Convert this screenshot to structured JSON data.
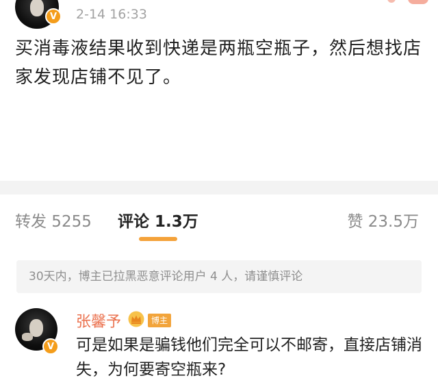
{
  "post": {
    "time": "2-14 16:33",
    "body": "买消毒液结果收到快递是两瓶空瓶子，然后想找店家发现店铺不见了。",
    "verified_badge": "V"
  },
  "tabs": {
    "repost": "转发 5255",
    "comment": "评论 1.3万",
    "like": "赞 23.5万"
  },
  "notice": {
    "text": "30天内，博主已拉黑恶意评论用户 4 人，请谨慎评论"
  },
  "comment": {
    "author": "张馨予",
    "verified_badge": "V",
    "role_badge": "博主",
    "text": "可是如果是骗钱他们完全可以不邮寄，直接店铺消失，为何要寄空瓶来?"
  },
  "colors": {
    "accent_orange": "#f4a23a",
    "name_color": "#eb7350",
    "badge_orange": "#f49d1b"
  },
  "icons": [
    "avatar",
    "verified-badge-icon",
    "crown-icon"
  ]
}
